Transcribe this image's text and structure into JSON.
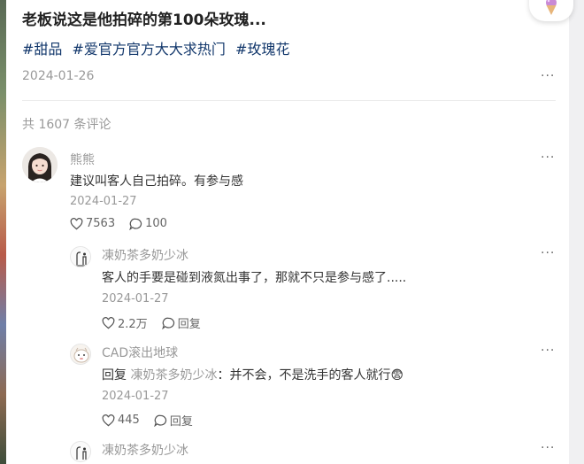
{
  "post": {
    "title": "老板说这是他拍碎的第100朵玫瑰...",
    "tags": [
      "#甜品",
      "#爱官方官方大大求热门",
      "#玫瑰花"
    ],
    "date": "2024-01-26",
    "more": "···"
  },
  "comments_header": {
    "count_text": "共 1607 条评论"
  },
  "comments": [
    {
      "name": "熊熊",
      "text": "建议叫客人自己拍碎。有参与感",
      "date": "2024-01-27",
      "likes": "7563",
      "replies": "100",
      "more": "···"
    }
  ],
  "replies": [
    {
      "name": "凍奶茶多奶少冰",
      "text": "客人的手要是碰到液氮出事了，那就不只是参与感了.....",
      "date": "2024-01-27",
      "likes": "2.2万",
      "reply_label": "回复",
      "more": "···"
    },
    {
      "name": "CAD滚出地球",
      "reply_prefix": "回复",
      "reply_to": "凍奶茶多奶少冰",
      "text": "：并不会，不是洗手的客人就行",
      "emoji": "😨",
      "date": "2024-01-27",
      "likes": "445",
      "reply_label": "回复",
      "more": "···"
    },
    {
      "name": "凍奶茶多奶少冰",
      "more": "···"
    }
  ],
  "icons": {
    "like": "heart-outline-icon",
    "comment": "speech-bubble-icon",
    "more": "more-dots-icon"
  }
}
